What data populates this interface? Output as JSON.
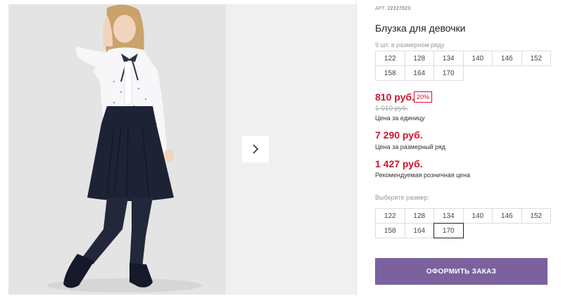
{
  "product": {
    "article_label": "АРТ.",
    "article_value": "22227023",
    "title": "Блузка для девочки",
    "pack_note": "9 шт. в размерном ряду"
  },
  "size_row_sizes": [
    "122",
    "128",
    "134",
    "140",
    "146",
    "152",
    "158",
    "164",
    "170"
  ],
  "prices": {
    "unit_price": "810 руб.",
    "discount": "20%",
    "old_price": "1 010 руб.",
    "unit_label": "Цена за единицу",
    "row_price": "7 290 руб.",
    "row_label": "Цена за размерный ряд",
    "retail_price": "1 427 руб.",
    "retail_label": "Рекомендуемая розничная цена"
  },
  "size_picker": {
    "label": "Выберите размер:",
    "sizes": [
      "122",
      "128",
      "134",
      "140",
      "146",
      "152",
      "158",
      "164",
      "170"
    ],
    "selected": "170"
  },
  "order_button_label": "ОФОРМИТЬ ЗАКАЗ",
  "gallery": {
    "next_icon": "chevron-right-icon"
  },
  "colors": {
    "price": "#d0142c",
    "button": "#7b619e"
  }
}
